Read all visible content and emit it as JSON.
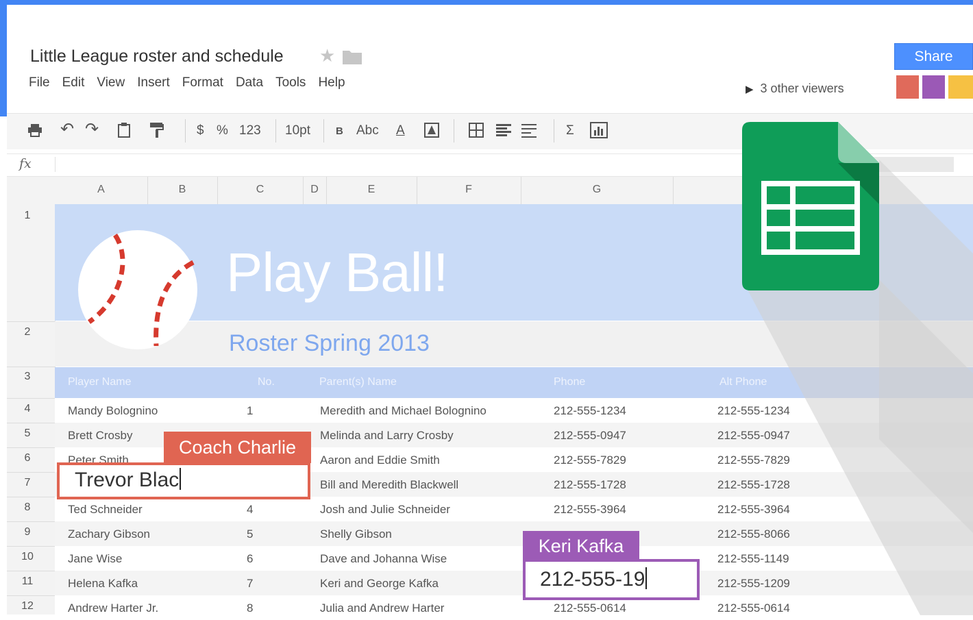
{
  "doc": {
    "title": "Little League roster and schedule",
    "star_icon": "star-icon",
    "folder_icon": "folder-icon"
  },
  "menu": [
    "File",
    "Edit",
    "View",
    "Insert",
    "Format",
    "Data",
    "Tools",
    "Help"
  ],
  "viewers": {
    "label": "3 other viewers",
    "icon": "triangle-right-icon"
  },
  "share": {
    "label": "Share",
    "color": "#4d90fe"
  },
  "avatars": [
    {
      "color": "#e06a5b",
      "icon": "avatar-red"
    },
    {
      "color": "#9b59b6",
      "icon": "avatar-purple"
    },
    {
      "color": "#f6c143",
      "icon": "avatar-yellow"
    }
  ],
  "toolbar": {
    "currency": "$",
    "percent": "%",
    "number_format": "123",
    "font_size": "10pt",
    "bold": "B",
    "strike": "Abc",
    "text_color": "A",
    "sum": "Σ",
    "icons": [
      "print-icon",
      "undo-icon",
      "redo-icon",
      "paste-icon",
      "paint-format-icon",
      "fill-color-icon",
      "borders-icon",
      "align-icon",
      "wrap-icon",
      "sum-icon",
      "chart-icon"
    ]
  },
  "formula_bar": {
    "fx": "fx",
    "value": ""
  },
  "columns": [
    "A",
    "B",
    "C",
    "D",
    "E",
    "F",
    "G"
  ],
  "rows": [
    "1",
    "2",
    "3",
    "4",
    "5",
    "6",
    "7",
    "8",
    "9",
    "10",
    "11",
    "12"
  ],
  "banner": {
    "title": "Play Ball!",
    "subtitle": "Roster Spring 2013",
    "baseball_icon": "baseball-icon",
    "colors": {
      "banner": "#c9dbf7",
      "header": "#c0d3f5",
      "subtitle": "#7ea7ee"
    }
  },
  "table": {
    "headers": [
      "Player Name",
      "No.",
      "Parent(s) Name",
      "Phone",
      "Alt Phone"
    ],
    "rows": [
      [
        "Mandy Bolognino",
        "1",
        "Meredith and Michael Bolognino",
        "212-555-1234",
        "212-555-1234"
      ],
      [
        "Brett Crosby",
        "",
        "Melinda and Larry Crosby",
        "212-555-0947",
        "212-555-0947"
      ],
      [
        "Peter Smith",
        "",
        "Aaron and Eddie Smith",
        "212-555-7829",
        "212-555-7829"
      ],
      [
        "",
        "",
        "Bill and Meredith Blackwell",
        "212-555-1728",
        "212-555-1728"
      ],
      [
        "Ted Schneider",
        "4",
        "Josh and Julie Schneider",
        "212-555-3964",
        "212-555-3964"
      ],
      [
        "Zachary Gibson",
        "5",
        "Shelly Gibson",
        "",
        "212-555-8066"
      ],
      [
        "Jane Wise",
        "6",
        "Dave and Johanna Wise",
        "",
        "212-555-1149"
      ],
      [
        "Helena Kafka",
        "7",
        "Keri and George Kafka",
        "",
        "212-555-1209"
      ],
      [
        "Andrew Harter Jr.",
        "8",
        "Julia and Andrew Harter",
        "212-555-0614",
        "212-555-0614"
      ]
    ]
  },
  "collaborators": [
    {
      "name": "Coach Charlie",
      "editing_value": "Trevor Blac",
      "color": "#e06552"
    },
    {
      "name": "Keri Kafka",
      "editing_value": "212-555-19",
      "color": "#9c5bb6"
    }
  ],
  "sheets_logo": {
    "icon": "google-sheets-icon",
    "color": "#0f9d58"
  }
}
